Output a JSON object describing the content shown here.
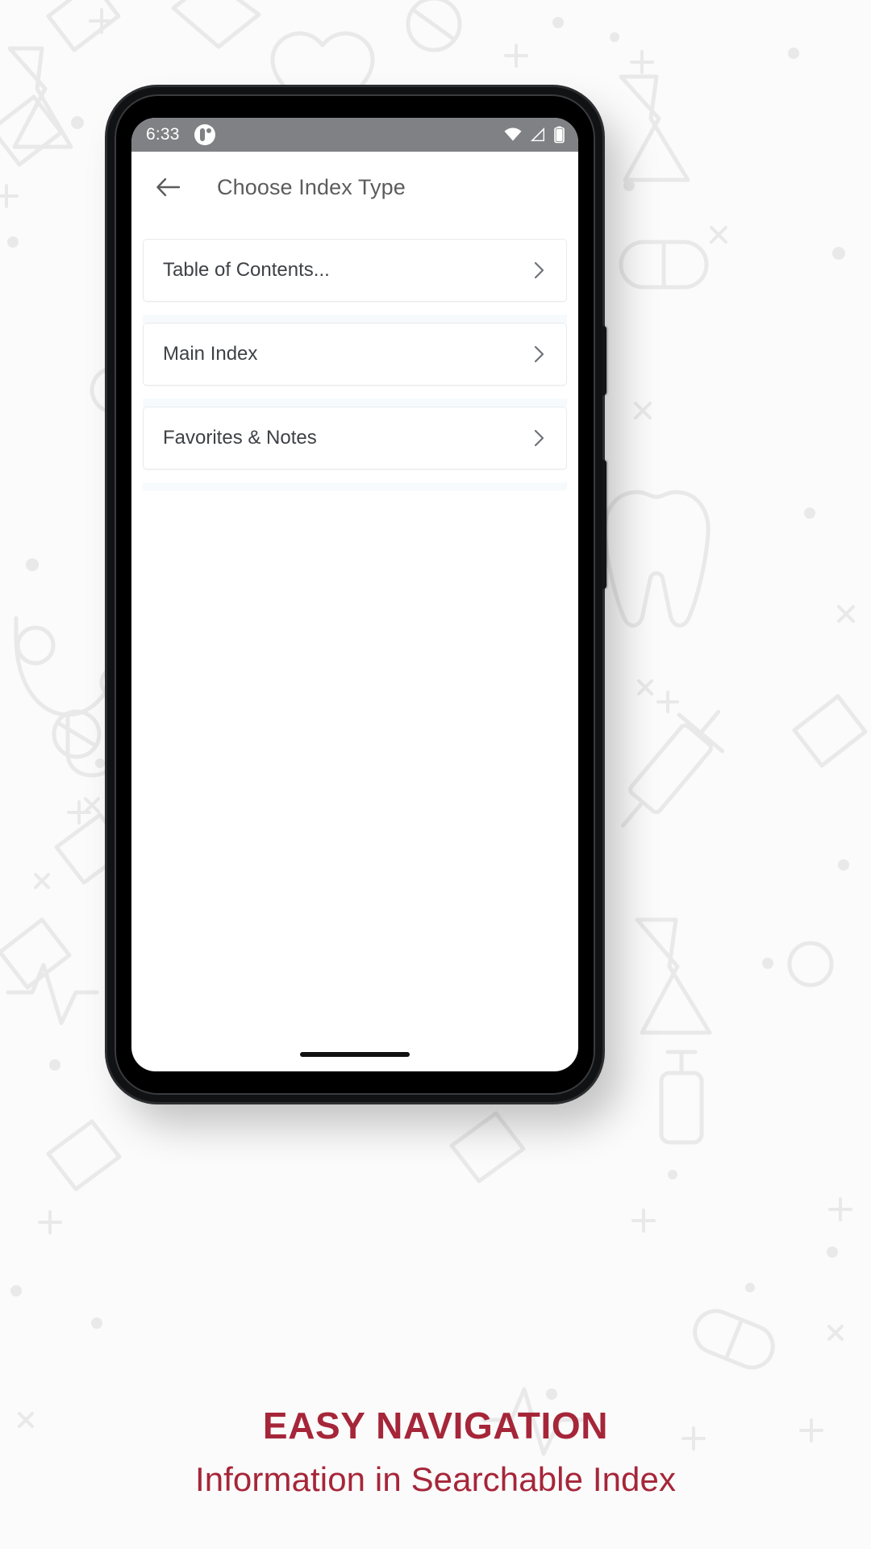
{
  "status_bar": {
    "time": "6:33",
    "notification_icon": "app-notification-icon",
    "wifi_icon": "wifi-icon",
    "signal_icon": "cellular-signal-icon",
    "battery_icon": "battery-icon"
  },
  "app_bar": {
    "back_icon": "back-arrow-icon",
    "title": "Choose Index Type"
  },
  "index_list": {
    "items": [
      {
        "label": "Table of Contents...",
        "chevron": "chevron-right-icon"
      },
      {
        "label": "Main Index",
        "chevron": "chevron-right-icon"
      },
      {
        "label": "Favorites & Notes",
        "chevron": "chevron-right-icon"
      }
    ]
  },
  "caption": {
    "headline": "EASY NAVIGATION",
    "subline": "Information in Searchable Index"
  },
  "colors": {
    "brand_red": "#a62639",
    "status_bar": "#7f8184",
    "card_border": "#e8eaec",
    "title_text": "#5c5c5c",
    "page_background": "#fbfbfb"
  }
}
